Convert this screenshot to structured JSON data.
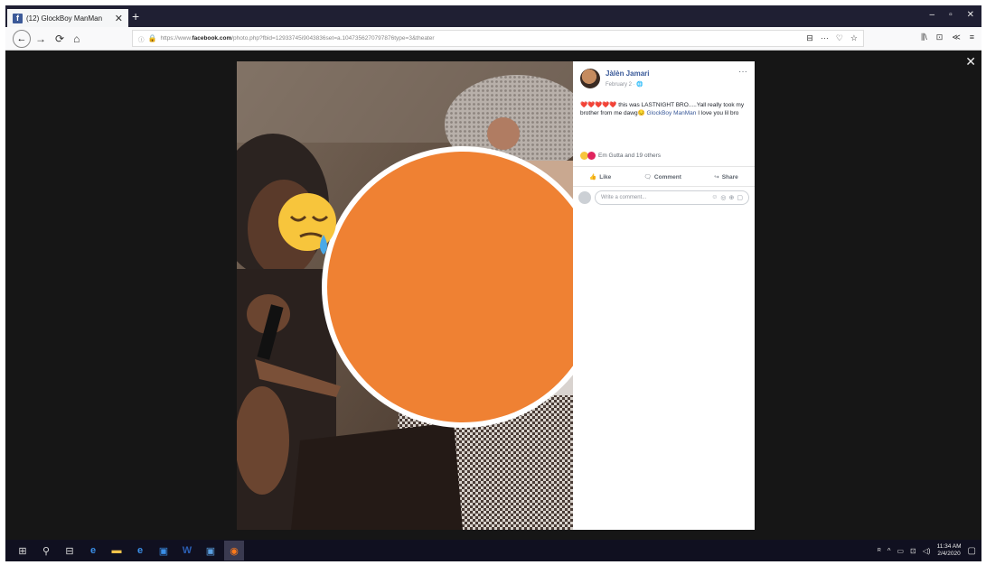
{
  "browser": {
    "tab_title": "(12) GlockBoy ManMan",
    "tab_favicon": "f",
    "tab_close": "✕",
    "new_tab": "+",
    "window_controls": [
      "–",
      "▫",
      "✕"
    ],
    "url_prefix": "https://www.",
    "url_domain": "facebook.com",
    "url_path": "/photo.php?fbid=12933745i9043836set=a.1047356270797876type=3&theater",
    "url_right_icons": [
      "⊟",
      "···",
      "♡",
      "☆"
    ],
    "right_tools": [
      "⫼\\",
      "⊡",
      "≪",
      "≡"
    ]
  },
  "viewer": {
    "close_label": "✕"
  },
  "post": {
    "author": "Jàlèn Jamari",
    "date": "February 2 · 🌐",
    "more": "···",
    "hearts": "❤️❤️❤️❤️❤️",
    "text_before": " this was LASTNIGHT BRO.....Yall really took my brother from me dawg😔 ",
    "tagged": "GlockBoy ManMan",
    "text_after": " I love you lil bro",
    "reactions_text": "Em Gutta and 19 others",
    "actions": {
      "like": "Like",
      "comment": "Comment",
      "share": "Share"
    },
    "comment_placeholder": "Write a comment...",
    "comment_icons": [
      "☺",
      "◎",
      "⊕",
      "▢"
    ]
  },
  "taskbar": {
    "items": [
      "⊞",
      "⚲",
      "⊟",
      "e",
      "▬",
      "e",
      "▣",
      "W",
      "▣",
      "◉"
    ],
    "tray_icons": [
      "ᴿ",
      "^",
      "▭",
      "⊡",
      "◁)"
    ],
    "time": "11:34 AM",
    "date": "2/4/2020"
  },
  "colors": {
    "facebook_blue": "#3b5998",
    "link_blue": "#385898",
    "orange_blur": "#ef8133"
  }
}
